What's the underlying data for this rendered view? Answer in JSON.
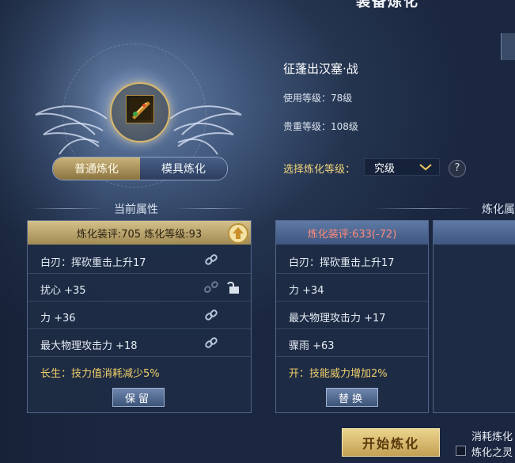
{
  "window": {
    "title": "装备炼化"
  },
  "tabs": [
    {
      "label": "普通炼化",
      "active": true
    },
    {
      "label": "模具炼化",
      "active": false
    }
  ],
  "equipment": {
    "name": "征蓬出汉塞·战",
    "use_level": "使用等级：78级",
    "value_level": "贵重等级：108级"
  },
  "refine_select": {
    "label": "选择炼化等级：",
    "value": "究级"
  },
  "help": {
    "label": "?"
  },
  "current": {
    "header": "当前属性",
    "panel_title": "炼化装评:705  炼化等级:93",
    "rows": [
      {
        "text": "白刃：挥砍重击上升17",
        "gold": false,
        "icon": "link-icon"
      },
      {
        "text": "扰心 +35",
        "gold": false,
        "icon": "broken-link-icon",
        "lock": "unlock-icon"
      },
      {
        "text": "力 +36",
        "gold": false,
        "icon": "link-icon"
      },
      {
        "text": "最大物理攻击力 +18",
        "gold": false,
        "icon": "link-icon"
      },
      {
        "text": "长生：技力值消耗减少5%",
        "gold": true
      }
    ],
    "button": "保留"
  },
  "refined": {
    "header": "炼化属",
    "panel_title": "炼化装评:633(-72)",
    "rows": [
      {
        "text": "白刃：挥砍重击上升17",
        "gold": false
      },
      {
        "text": "力 +34",
        "gold": false
      },
      {
        "text": "最大物理攻击力 +17",
        "gold": false
      },
      {
        "text": "骤雨 +63",
        "gold": false
      },
      {
        "text": "开：技能威力增加2%",
        "gold": true
      }
    ],
    "button": "替换"
  },
  "actions": {
    "start": "开始炼化",
    "consume": "消耗炼化",
    "checkbox_label": "炼化之灵"
  },
  "colors": {
    "gold_text": "#f1d06a",
    "warning_red": "#ff8a7a",
    "panel_bg": "#1e2c44"
  }
}
